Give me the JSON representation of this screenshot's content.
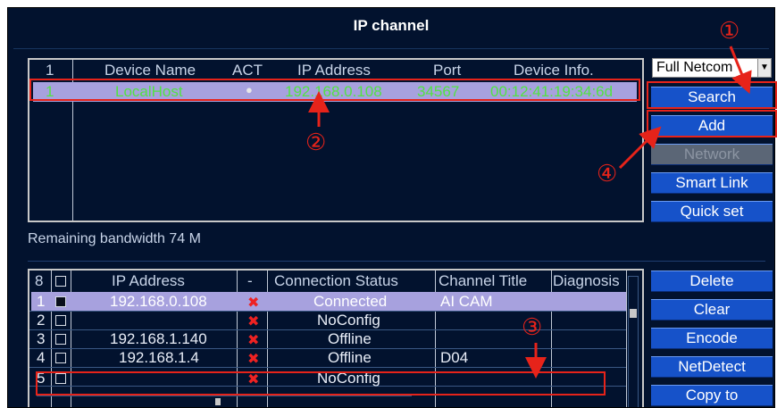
{
  "title": "IP channel",
  "top_table": {
    "headers": [
      "1",
      "Device Name",
      "ACT",
      "IP Address",
      "Port",
      "Device Info."
    ],
    "rows": [
      {
        "num": "1",
        "name": "LocalHost",
        "ip": "192.168.0.108",
        "port": "34567",
        "info": "00:12:41:19:34:6d"
      }
    ]
  },
  "dropdown": {
    "value": "Full Netcom"
  },
  "buttons_top": {
    "search": "Search",
    "add": "Add",
    "network": "Network",
    "smart_link": "Smart Link",
    "quick_set": "Quick set"
  },
  "bandwidth": "Remaining bandwidth  74 M",
  "bottom_table": {
    "headers": [
      "8",
      "IP Address",
      "-",
      "Connection Status",
      "Channel Title",
      "Diagnosis"
    ],
    "rows": [
      {
        "num": "1",
        "ip": "192.168.0.108",
        "status": "Connected",
        "title": "AI CAM"
      },
      {
        "num": "2",
        "ip": "",
        "status": "NoConfig",
        "title": ""
      },
      {
        "num": "3",
        "ip": "192.168.1.140",
        "status": "Offline",
        "title": ""
      },
      {
        "num": "4",
        "ip": "192.168.1.4",
        "status": "Offline",
        "title": "D04"
      },
      {
        "num": "5",
        "ip": "",
        "status": "NoConfig",
        "title": ""
      }
    ]
  },
  "buttons_bottom": {
    "delete": "Delete",
    "clear": "Clear",
    "encode": "Encode",
    "netdetect": "NetDetect",
    "copy_to": "Copy to"
  },
  "callouts": [
    "①",
    "②",
    "③",
    "④"
  ],
  "colors": {
    "background": "#02122e",
    "button": "#1652c9",
    "highlight": "#a7a1de",
    "annotation": "#e6231a",
    "green_text": "#53e244"
  }
}
